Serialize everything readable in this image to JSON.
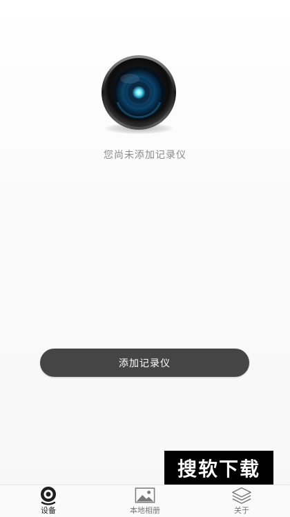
{
  "empty_state": {
    "message": "您尚未添加记录仪",
    "icon": "camera-lens-icon"
  },
  "actions": {
    "add_button_label": "添加记录仪"
  },
  "watermark": {
    "text": "搜软下载"
  },
  "tabs": [
    {
      "label": "设备",
      "icon": "webcam-icon",
      "active": true
    },
    {
      "label": "本地相册",
      "icon": "picture-icon",
      "active": false
    },
    {
      "label": "关于",
      "icon": "layers-icon",
      "active": false
    }
  ],
  "colors": {
    "button_bg": "#454545",
    "text_muted": "#8a8a8a",
    "active_tab": "#222222"
  }
}
